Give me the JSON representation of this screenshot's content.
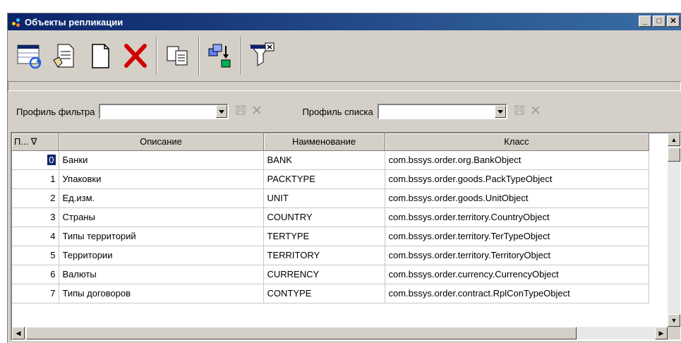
{
  "window": {
    "title": "Объекты репликации",
    "minimize": "_",
    "maximize": "□",
    "close": "✕"
  },
  "toolbar": {
    "buttons": [
      "refresh-icon",
      "properties-icon",
      "new-document-icon",
      "delete-icon",
      "copy-icon",
      "tree-move-icon",
      "filter-clear-icon"
    ]
  },
  "filter": {
    "filter_profile_label": "Профиль фильтра",
    "filter_profile_value": "",
    "list_profile_label": "Профиль списка",
    "list_profile_value": ""
  },
  "table": {
    "columns": [
      "П... ∇",
      "Описание",
      "Наименование",
      "Класс"
    ],
    "rows": [
      {
        "num": "0",
        "desc": "Банки",
        "name": "BANK",
        "cls": "com.bssys.order.org.BankObject"
      },
      {
        "num": "1",
        "desc": "Упаковки",
        "name": "PACKTYPE",
        "cls": "com.bssys.order.goods.PackTypeObject"
      },
      {
        "num": "2",
        "desc": "Ед.изм.",
        "name": "UNIT",
        "cls": "com.bssys.order.goods.UnitObject"
      },
      {
        "num": "3",
        "desc": "Страны",
        "name": "COUNTRY",
        "cls": "com.bssys.order.territory.CountryObject"
      },
      {
        "num": "4",
        "desc": "Типы территорий",
        "name": "TERTYPE",
        "cls": "com.bssys.order.territory.TerTypeObject"
      },
      {
        "num": "5",
        "desc": "Территории",
        "name": "TERRITORY",
        "cls": "com.bssys.order.territory.TerritoryObject"
      },
      {
        "num": "6",
        "desc": "Валюты",
        "name": "CURRENCY",
        "cls": "com.bssys.order.currency.CurrencyObject"
      },
      {
        "num": "7",
        "desc": "Типы договоров",
        "name": "CONTYPE",
        "cls": "com.bssys.order.contract.RplConTypeObject"
      }
    ]
  }
}
